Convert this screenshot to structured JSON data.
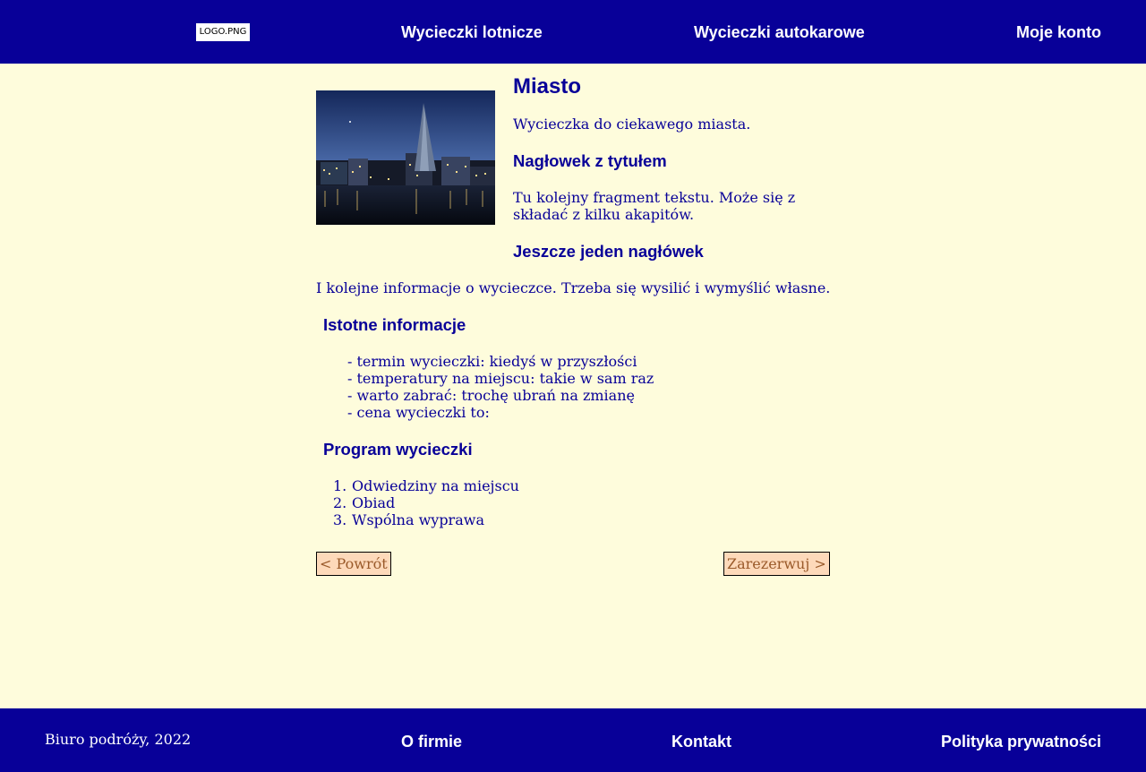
{
  "header": {
    "logo_text": "LOGO.PNG",
    "nav": [
      {
        "label": "Wycieczki lotnicze"
      },
      {
        "label": "Wycieczki autokarowe"
      },
      {
        "label": "Moje konto"
      }
    ]
  },
  "trip": {
    "title": "Miasto",
    "intro": "Wycieczka do ciekawego miasta.",
    "heading1": "Nagłowek z tytułem",
    "para1_line1": "Tu kolejny fragment tekstu. Może się z",
    "para1_line2": "składać z kilku akapitów.",
    "heading2": "Jeszcze jeden nagłówek",
    "para2": "I kolejne informacje o wycieczce. Trzeba się wysilić i wymyślić własne.",
    "info_heading": "Istotne informacje",
    "info_items": [
      "- termin wycieczki: kiedyś w przyszłości",
      "- temperatury na miejscu: takie w sam raz",
      "- warto zabrać: trochę ubrań na zmianę",
      "- cena wycieczki to:"
    ],
    "program_heading": "Program wycieczki",
    "program_items": [
      "Odwiedziny na miejscu",
      "Obiad",
      "Wspólna wyprawa"
    ],
    "program_numbers": [
      "1.",
      "2.",
      "3."
    ],
    "back_label": "< Powrót",
    "book_label": "Zarezerwuj >"
  },
  "footer": {
    "copyright": "Biuro podróży, 2022",
    "links": [
      {
        "label": "O firmie"
      },
      {
        "label": "Kontakt"
      },
      {
        "label": "Polityka prywatności"
      }
    ]
  },
  "colors": {
    "primary": "#080098",
    "background": "#fefcdc",
    "button_bg": "#fdd9ba",
    "button_text": "#9a5a2a"
  }
}
